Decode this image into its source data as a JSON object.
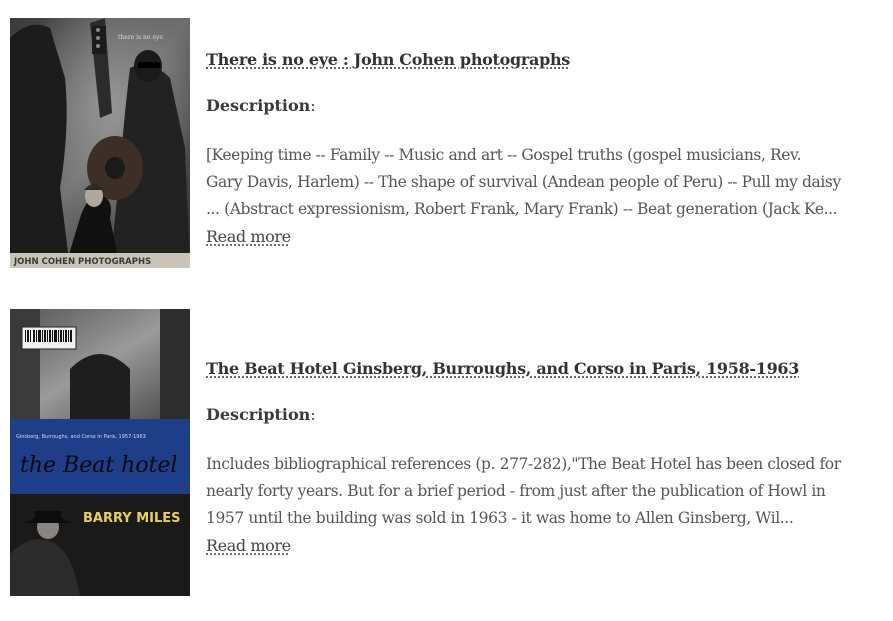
{
  "results": [
    {
      "title": "There is no eye : John Cohen photographs",
      "description_label": "Description",
      "description_lines": [
        "[Keeping time -- Family -- Music and art -- Gospel truths (gospel musicians, Rev.",
        "Gary Davis, Harlem) -- The shape of survival (Andean people of Peru) -- Pull my daisy",
        "... (Abstract expressionism, Robert Frank, Mary Frank) -- Beat generation (Jack Ke..."
      ],
      "read_more": "Read more",
      "cover": {
        "top_text": "there is no eye",
        "bottom_text": "JOHN COHEN PHOTOGRAPHS"
      }
    },
    {
      "title": "The Beat Hotel Ginsberg, Burroughs, and Corso in Paris, 1958-1963",
      "description_label": "Description",
      "description_lines": [
        "Includes bibliographical references (p. 277-282),\"The Beat Hotel has been closed for",
        "nearly forty years. But for a brief period - from just after the publication of Howl in",
        "1957 until the building was sold in 1963 - it was home to Allen Ginsberg, Wil..."
      ],
      "read_more": "Read more",
      "cover": {
        "band_text": "Ginsberg, Burroughs, and Corso in Paris, 1957-1963",
        "script_title": "the Beat hotel",
        "author": "BARRY MILES"
      }
    }
  ]
}
